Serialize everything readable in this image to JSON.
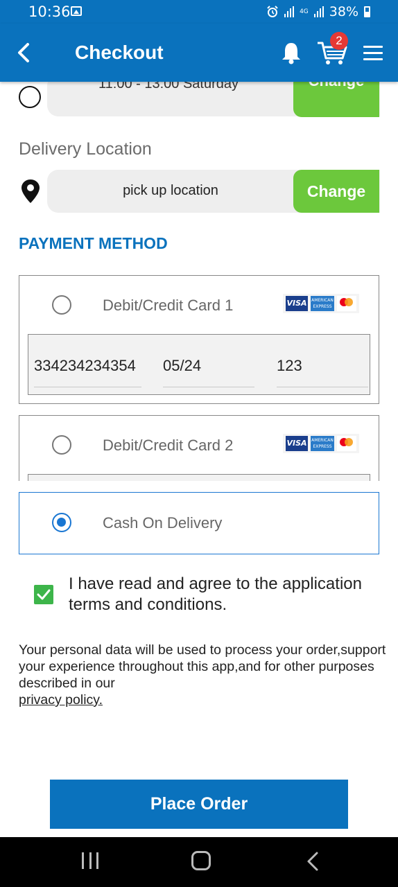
{
  "status_bar": {
    "time": "10:36",
    "network": "4G",
    "battery": "38%"
  },
  "app_bar": {
    "title": "Checkout",
    "cart_count": "2",
    "accent_color": "#0a72bd"
  },
  "schedule_row": {
    "partial_text": "11:00 - 13:00 Saturday",
    "button_label": "Change"
  },
  "delivery": {
    "section_label": "Delivery Location",
    "location_value": "pick up location",
    "change_label": "Change"
  },
  "payment": {
    "heading": "PAYMENT METHOD",
    "options": [
      {
        "label": "Debit/Credit Card 1",
        "selected": false,
        "card_number": "334234234354",
        "expiry": "05/24",
        "cvv": "123"
      },
      {
        "label": "Debit/Credit Card 2",
        "selected": false
      },
      {
        "label": "Cash On Delivery",
        "selected": true
      }
    ],
    "logos": [
      "visa-logo",
      "amex-logo",
      "mastercard-logo"
    ]
  },
  "terms": {
    "checked": true,
    "text": "I have read and agree to the application terms and conditions."
  },
  "privacy": {
    "text": "Your personal data will be used to process your order,support your experience throughout this app,and for other purposes described in our",
    "link_text": "privacy policy."
  },
  "actions": {
    "place_order_label": "Place Order"
  },
  "colors": {
    "primary": "#0a72bd",
    "change_button": "#6cc83c",
    "checkbox": "#3db54a",
    "badge": "#e53935"
  }
}
